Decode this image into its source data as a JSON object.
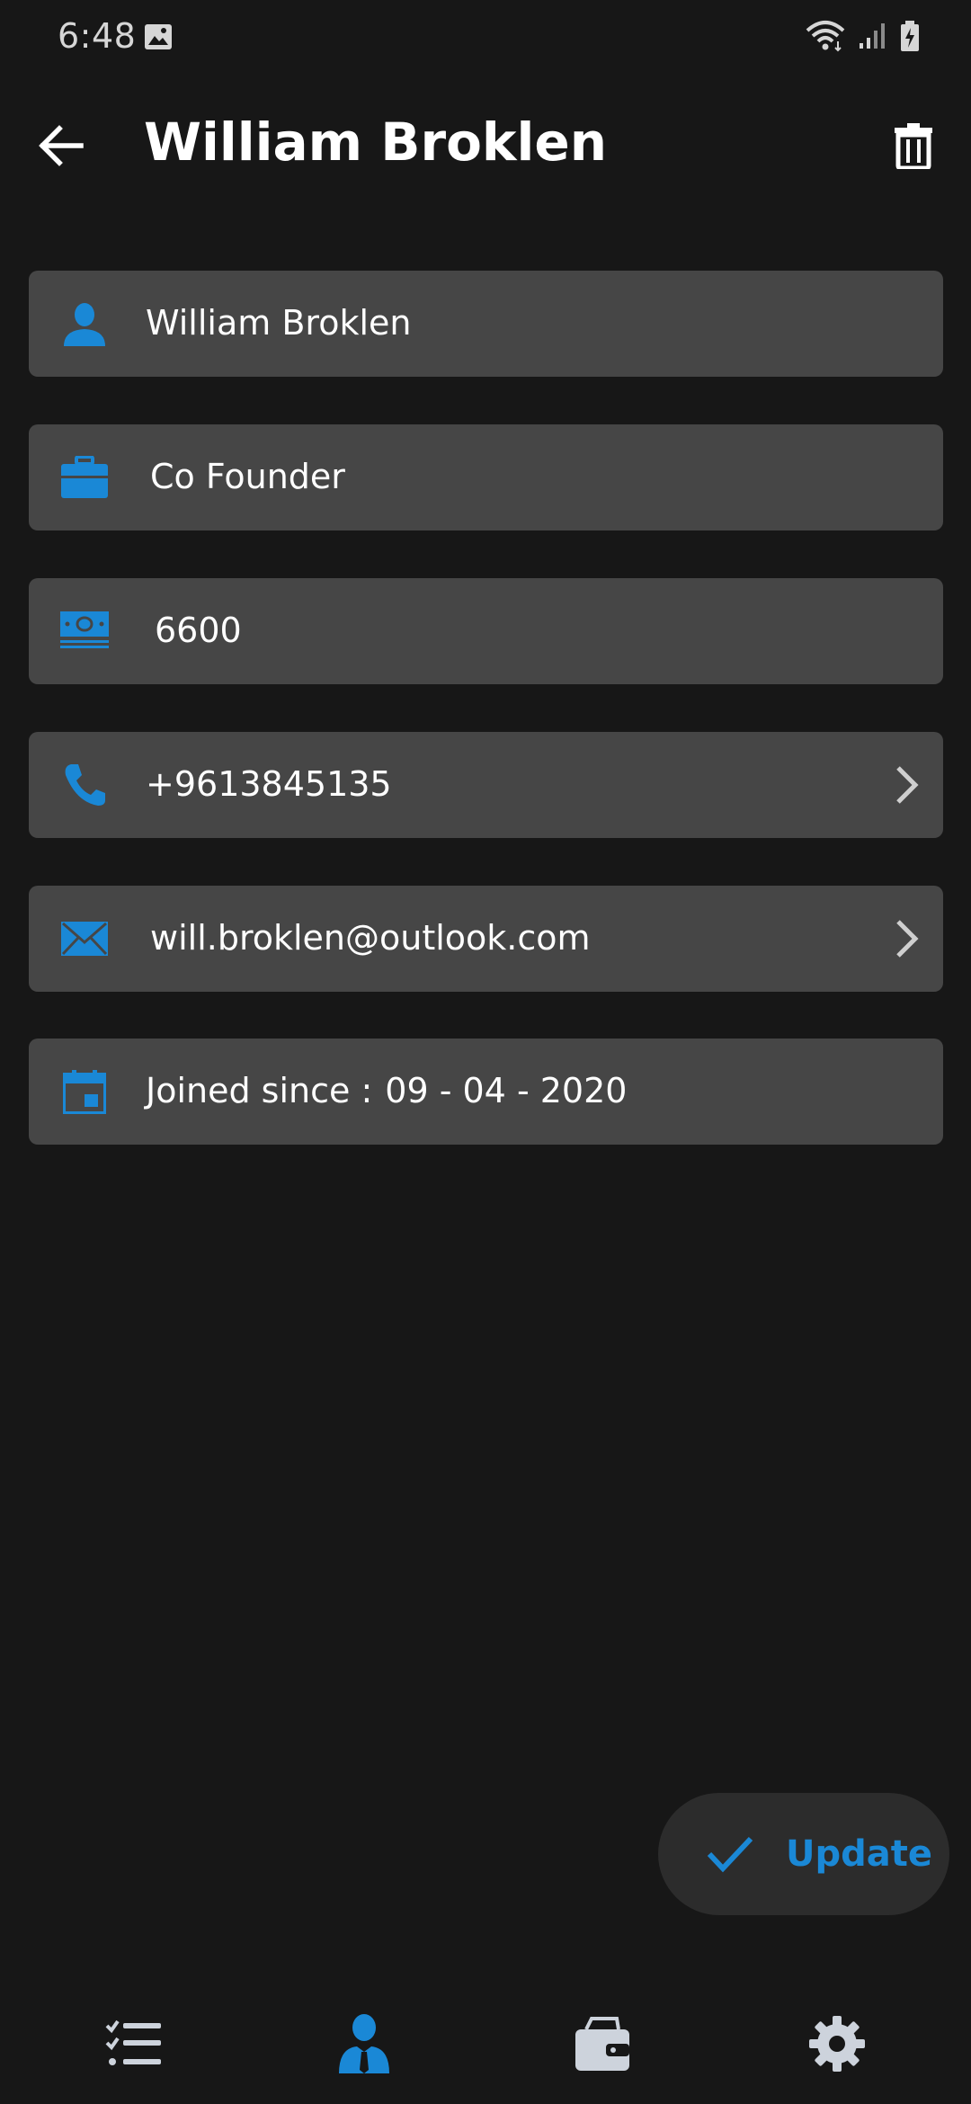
{
  "status_bar": {
    "time": "6:48"
  },
  "app_bar": {
    "title": "William Broklen"
  },
  "fields": {
    "name": "William Broklen",
    "position": "Co Founder",
    "salary": "6600",
    "phone": "+9613845135",
    "email": "will.broklen@outlook.com",
    "joined_label": "Joined since :",
    "joined_date": "09 - 04 - 2020"
  },
  "fab": {
    "label": "Update"
  },
  "colors": {
    "background": "#171717",
    "field_bg": "#464646",
    "accent": "#1a88d6",
    "icon_gray": "#cdd3dc"
  },
  "icons": {
    "status": [
      "image-icon",
      "wifi-icon",
      "signal-icon",
      "battery-icon"
    ],
    "fields": [
      "person-icon",
      "briefcase-icon",
      "money-icon",
      "phone-icon",
      "mail-icon",
      "calendar-icon"
    ],
    "nav": [
      "checklist-icon",
      "employee-icon",
      "wallet-icon",
      "gear-icon"
    ]
  }
}
